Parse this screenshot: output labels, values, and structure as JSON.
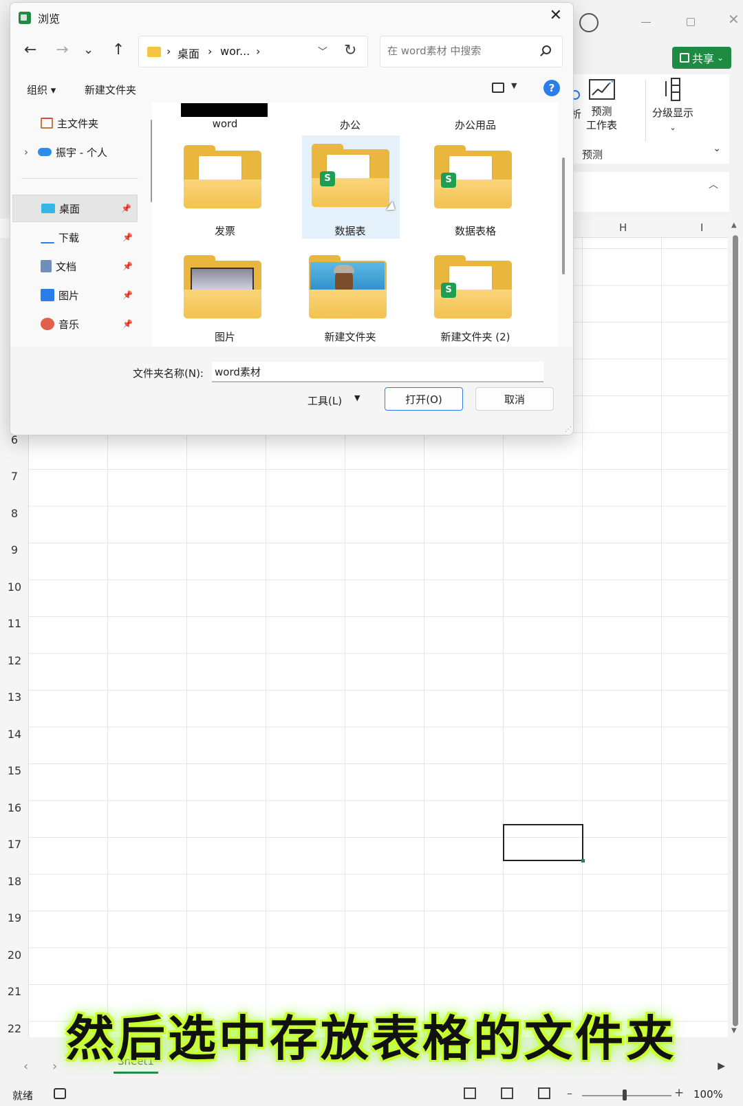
{
  "dialog": {
    "title": "浏览",
    "close": "✕",
    "nav": {
      "back": "←",
      "forward": "→",
      "recent": "⌄",
      "up": "↑"
    },
    "address": {
      "sep": "›",
      "crumbs": [
        "桌面",
        "wor..."
      ],
      "refresh": "↻"
    },
    "search": {
      "placeholder": "在 word素材 中搜索"
    },
    "toolbar": {
      "organize": "组织 ▾",
      "new_folder": "新建文件夹",
      "view_dd": "▼",
      "help": "?"
    },
    "nav_pane": {
      "items": [
        {
          "label": "主文件夹"
        },
        {
          "label": "振宇 - 个人",
          "expander": "›"
        },
        {
          "label": "桌面",
          "pin": "📌"
        },
        {
          "label": "下载",
          "pin": "📌"
        },
        {
          "label": "文档",
          "pin": "📌"
        },
        {
          "label": "图片",
          "pin": "📌"
        },
        {
          "label": "音乐",
          "pin": "📌"
        }
      ]
    },
    "folders_top": [
      "word",
      "办公",
      "办公用品"
    ],
    "folders": [
      {
        "name": "发票"
      },
      {
        "name": "数据表",
        "badge": "S"
      },
      {
        "name": "数据表格",
        "badge": "S"
      },
      {
        "name": "图片"
      },
      {
        "name": "新建文件夹"
      },
      {
        "name": "新建文件夹 (2)",
        "badge": "S"
      }
    ],
    "filename_label": "文件夹名称(N):",
    "filename_value": "word素材",
    "tools_label": "工具(L)",
    "tools_dd": "▼",
    "open_button": "打开(O)",
    "cancel_button": "取消"
  },
  "excel": {
    "share_button": "共享",
    "share_dd": "⌄",
    "ribbon": {
      "analyze": "分析",
      "analyze_dd": "⌄",
      "forecast_sheet_1": "预测",
      "forecast_sheet_2": "工作表",
      "outline": "分级显示",
      "outline_dd": "⌄",
      "group": "预测",
      "collapse": "⌄"
    },
    "columns": [
      "H",
      "I"
    ],
    "rows": [
      "6",
      "7",
      "8",
      "9",
      "10",
      "11",
      "12",
      "13",
      "14",
      "15",
      "16",
      "17",
      "18",
      "19",
      "20",
      "21",
      "22"
    ],
    "sheet_nav_prev": "‹",
    "sheet_nav_next": "›",
    "sheet_tab": "Sheet1",
    "scroll_right": "▶",
    "status_ready": "就绪",
    "zoom": "100%",
    "zoom_minus": "–",
    "zoom_plus": "+"
  },
  "subtitle": "然后选中存放表格的文件夹"
}
